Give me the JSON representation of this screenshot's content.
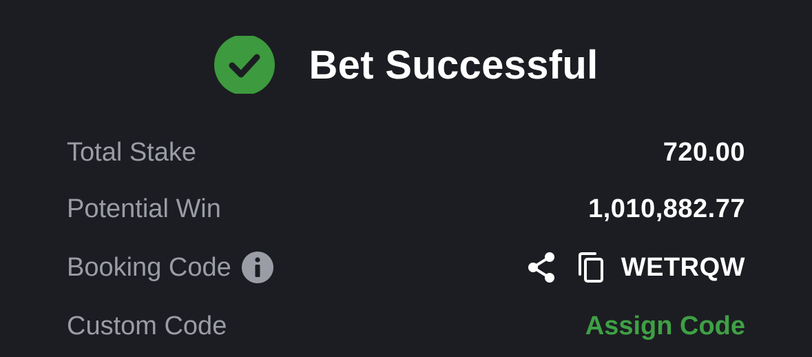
{
  "header": {
    "title": "Bet Successful",
    "icon": "check-circle-icon",
    "icon_color": "#3d9a3e"
  },
  "rows": [
    {
      "label": "Total Stake",
      "value": "720.00"
    },
    {
      "label": "Potential Win",
      "value": "1,010,882.77"
    },
    {
      "label": "Booking Code",
      "value": "WETRQW",
      "icons": [
        "info-icon",
        "share-icon",
        "copy-icon"
      ]
    },
    {
      "label": "Custom Code",
      "action": "Assign Code"
    }
  ],
  "colors": {
    "background": "#1c1d22",
    "label": "#9b9da6",
    "value": "#ffffff",
    "accent": "#3fa045"
  }
}
